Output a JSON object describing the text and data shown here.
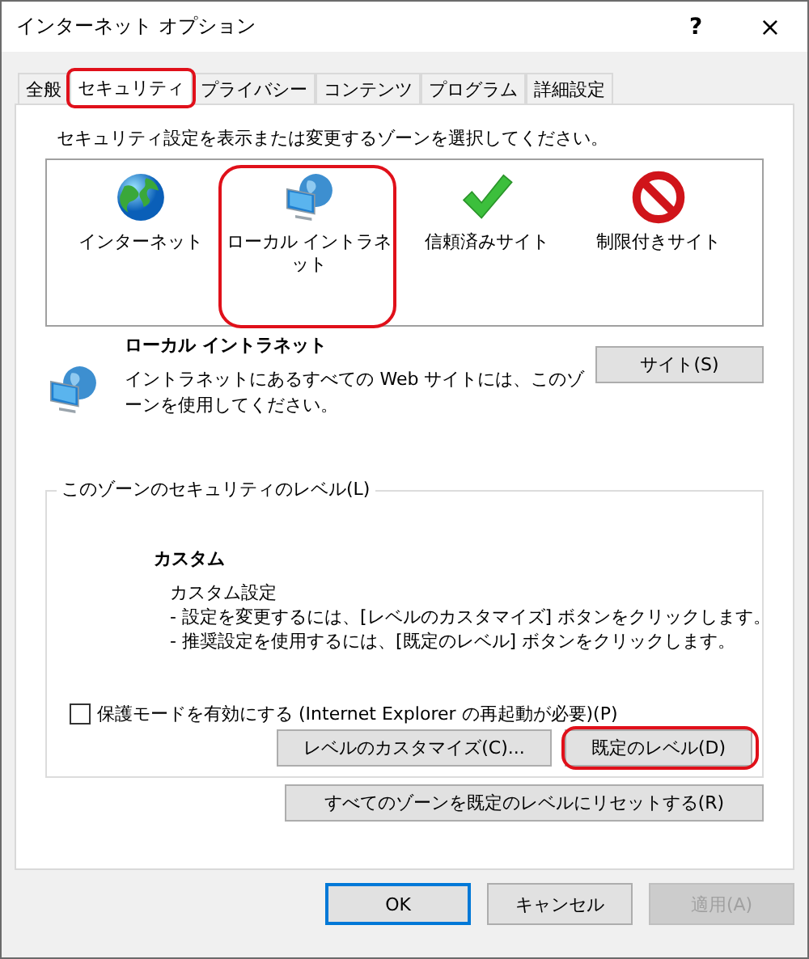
{
  "window": {
    "title": "インターネット オプション",
    "help": "?",
    "close": "×"
  },
  "tabs": [
    {
      "label": "全般",
      "selected": false,
      "highlighted": false
    },
    {
      "label": "セキュリティ",
      "selected": true,
      "highlighted": true
    },
    {
      "label": "プライバシー",
      "selected": false,
      "highlighted": false
    },
    {
      "label": "コンテンツ",
      "selected": false,
      "highlighted": false
    },
    {
      "label": "プログラム",
      "selected": false,
      "highlighted": false
    },
    {
      "label": "詳細設定",
      "selected": false,
      "highlighted": false
    }
  ],
  "zone_prompt": "セキュリティ設定を表示または変更するゾーンを選択してください。",
  "zones": [
    {
      "kind": "internet",
      "label": "インターネット",
      "highlighted": false
    },
    {
      "kind": "intranet",
      "label": "ローカル イントラネット",
      "highlighted": true
    },
    {
      "kind": "trusted",
      "label": "信頼済みサイト",
      "highlighted": false
    },
    {
      "kind": "restricted",
      "label": "制限付きサイト",
      "highlighted": false
    }
  ],
  "zone_info": {
    "kind": "intranet",
    "name": "ローカル イントラネット",
    "description": "イントラネットにあるすべての Web サイトには、このゾーンを使用してください。",
    "button": "サイト(S)"
  },
  "level_group": {
    "legend": "このゾーンのセキュリティのレベル(L)",
    "level_name": "カスタム",
    "lines": [
      "カスタム設定",
      "- 設定を変更するには、[レベルのカスタマイズ] ボタンをクリックします。",
      "- 推奨設定を使用するには、[既定のレベル] ボタンをクリックします。"
    ],
    "protected_mode": {
      "label": "保護モードを有効にする (Internet Explorer の再起動が必要)(P)",
      "checked": false
    },
    "buttons": [
      {
        "label": "レベルのカスタマイズ(C)...",
        "highlighted": false
      },
      {
        "label": "既定のレベル(D)",
        "highlighted": true
      }
    ]
  },
  "reset_button": "すべてのゾーンを既定のレベルにリセットする(R)",
  "dialog_buttons": [
    {
      "label": "OK",
      "kind": "default",
      "disabled": false
    },
    {
      "label": "キャンセル",
      "kind": "normal",
      "disabled": false
    },
    {
      "label": "適用(A)",
      "kind": "normal",
      "disabled": true
    }
  ]
}
